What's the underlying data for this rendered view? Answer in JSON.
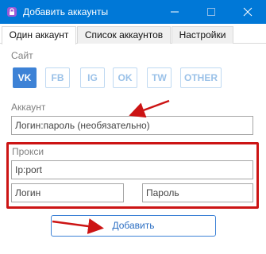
{
  "window": {
    "title": "Добавить аккаунты",
    "icon": "lock-icon"
  },
  "tabs": [
    {
      "label": "Один аккаунт",
      "active": true
    },
    {
      "label": "Список аккаунтов",
      "active": false
    },
    {
      "label": "Настройки",
      "active": false
    }
  ],
  "site": {
    "label": "Сайт",
    "buttons": [
      "VK",
      "FB",
      "IG",
      "OK",
      "TW",
      "OTHER"
    ],
    "selected": "VK"
  },
  "account": {
    "label": "Аккаунт",
    "placeholder": "Логин:пароль (необязательно)"
  },
  "proxy": {
    "label": "Прокси",
    "address_placeholder": "Ip:port",
    "login_placeholder": "Логин",
    "password_placeholder": "Пароль"
  },
  "add_button": "Добавить",
  "colors": {
    "titlebar": "#0078d7",
    "accent": "#3d82d6",
    "annotation": "#cc1414"
  }
}
